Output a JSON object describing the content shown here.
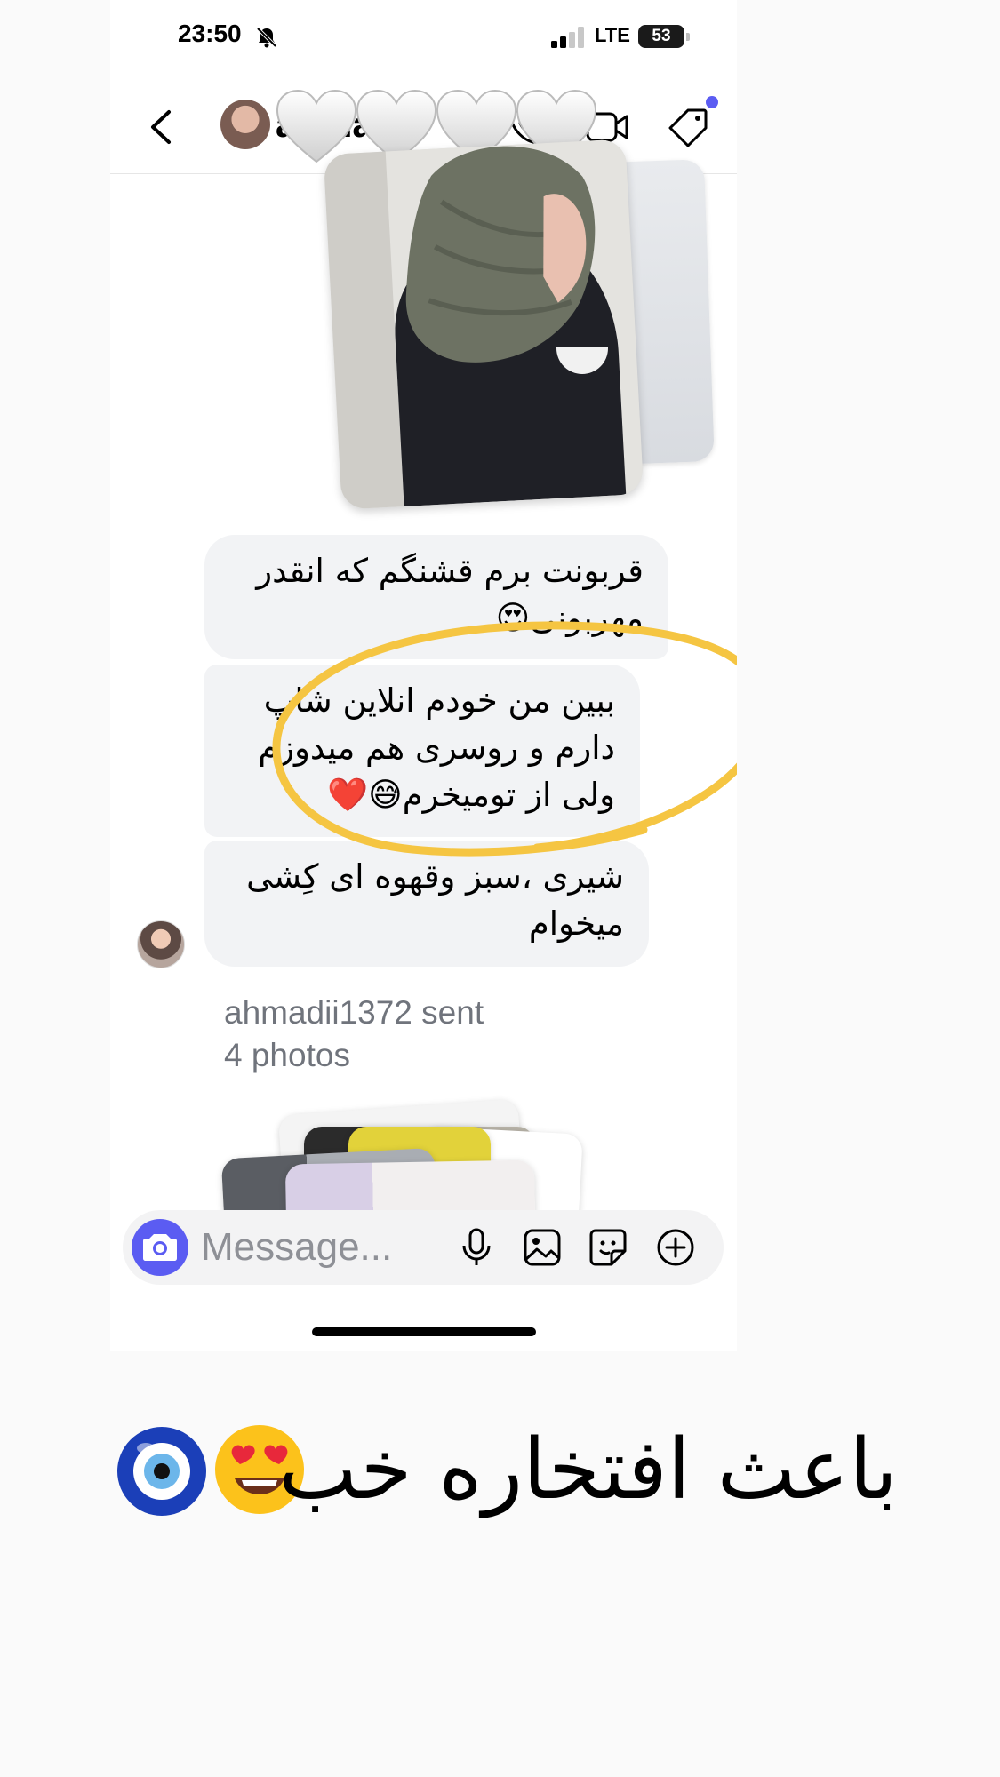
{
  "status_bar": {
    "time": "23:50",
    "network": "LTE",
    "battery": "53"
  },
  "header": {
    "contact_name": "ahma",
    "overlay_emoji": "🤍🤍🤍🤍"
  },
  "messages": [
    {
      "text": "قربونت برم قشنگم که انقدر\nمهربونی😍"
    },
    {
      "text": "ببین من خودم انلاین شاپ\nدارم و روسری هم میدوزم\nولی از تومیخرم😅❤️"
    },
    {
      "text": "شیری ،سبز وقهوه ای کِشی\nمیخوام"
    }
  ],
  "photos_notice": "ahmadii1372 sent\n4 photos",
  "composer": {
    "placeholder": "Message..."
  },
  "caption": {
    "text": "باعث افتخاره خب"
  },
  "colors": {
    "accent": "#5b5cf2",
    "bubble": "#f2f3f5",
    "highlight": "#f5c542",
    "muted_text": "#70747c"
  },
  "icons": [
    "bell-muted-icon",
    "signal-icon",
    "back-icon",
    "chevron-right-icon",
    "phone-icon",
    "video-icon",
    "tag-icon",
    "camera-icon",
    "mic-icon",
    "gallery-icon",
    "sticker-icon",
    "plus-icon",
    "nazar-icon",
    "heart-eyes-icon"
  ]
}
